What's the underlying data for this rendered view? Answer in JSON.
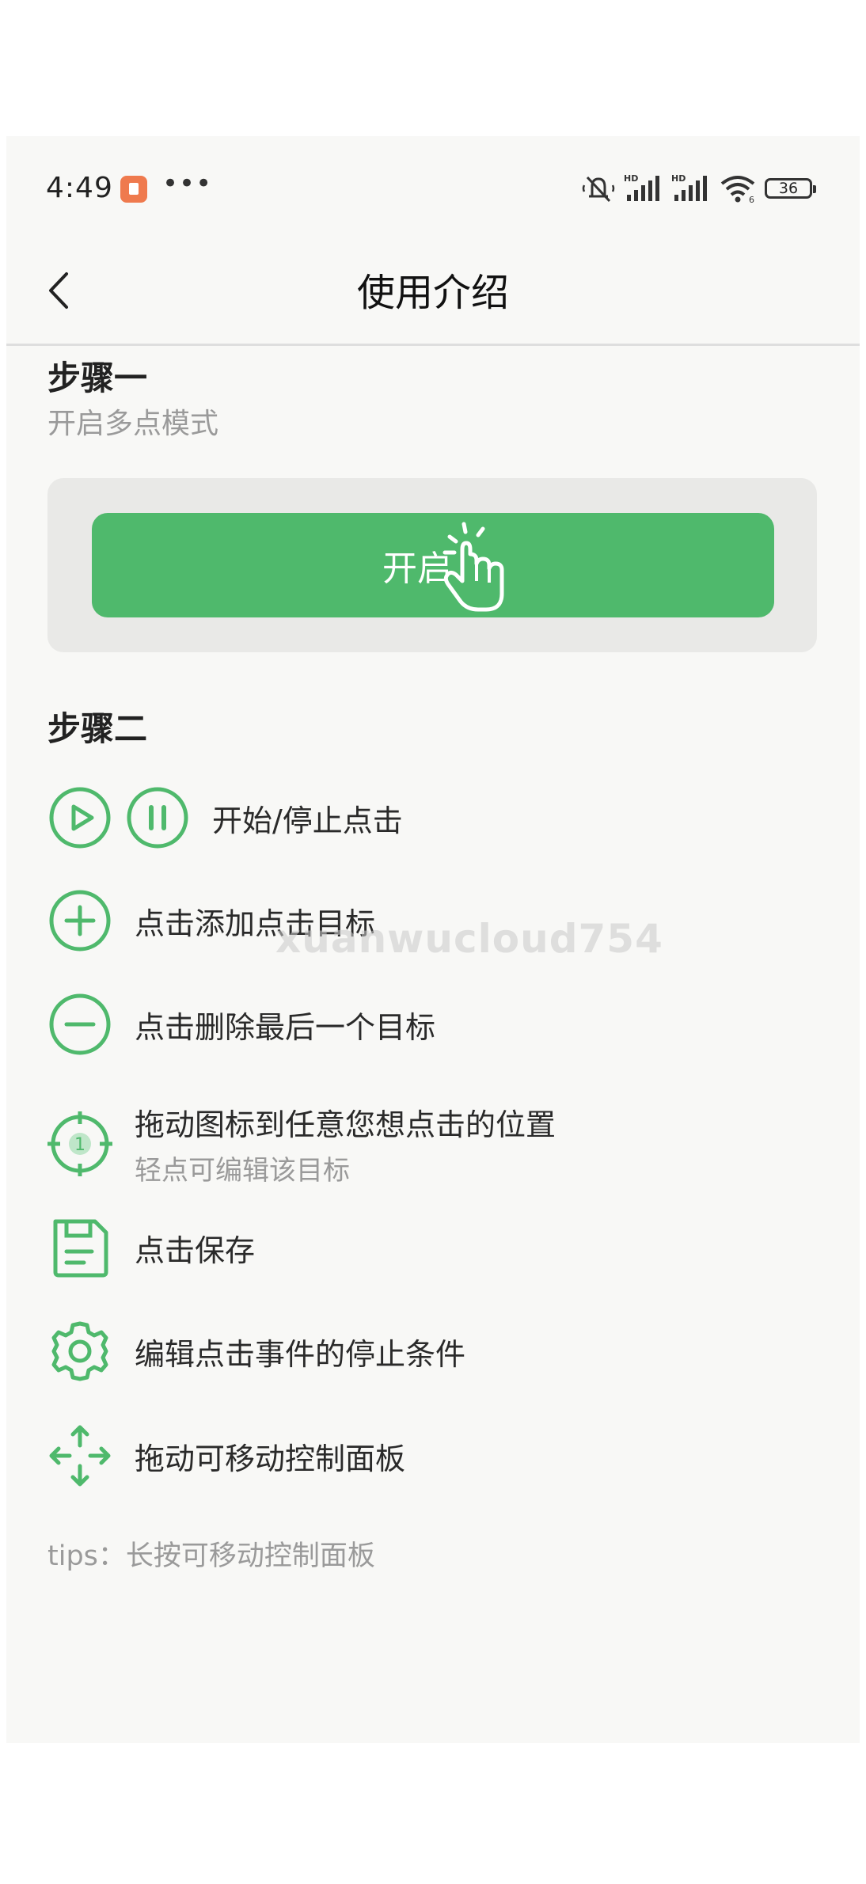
{
  "status_bar": {
    "time": "4:49",
    "dots": "•••",
    "battery": "36",
    "icons": [
      "app-icon",
      "mute-icon",
      "hd-signal-icon",
      "hd-signal-icon",
      "wifi-icon",
      "battery-icon"
    ]
  },
  "header": {
    "title": "使用介绍"
  },
  "step1": {
    "title": "步骤一",
    "subtitle": "开启多点模式",
    "button_label": "开启"
  },
  "step2": {
    "title": "步骤二",
    "items": [
      {
        "label": "开始/停止点击",
        "icon": "play-pause-icon"
      },
      {
        "label": "点击添加点击目标",
        "icon": "add-icon"
      },
      {
        "label": "点击删除最后一个目标",
        "icon": "remove-icon"
      },
      {
        "label": "拖动图标到任意您想点击的位置",
        "sub": "轻点可编辑该目标",
        "icon": "target-icon",
        "target_number": "1"
      },
      {
        "label": "点击保存",
        "icon": "save-icon"
      },
      {
        "label": "编辑点击事件的停止条件",
        "icon": "gear-icon"
      },
      {
        "label": "拖动可移动控制面板",
        "icon": "move-icon"
      }
    ]
  },
  "tips": "tips：长按可移动控制面板",
  "watermark": "xuanwucloud754",
  "colors": {
    "accent": "#4fb96c",
    "background": "#f8f8f6"
  }
}
